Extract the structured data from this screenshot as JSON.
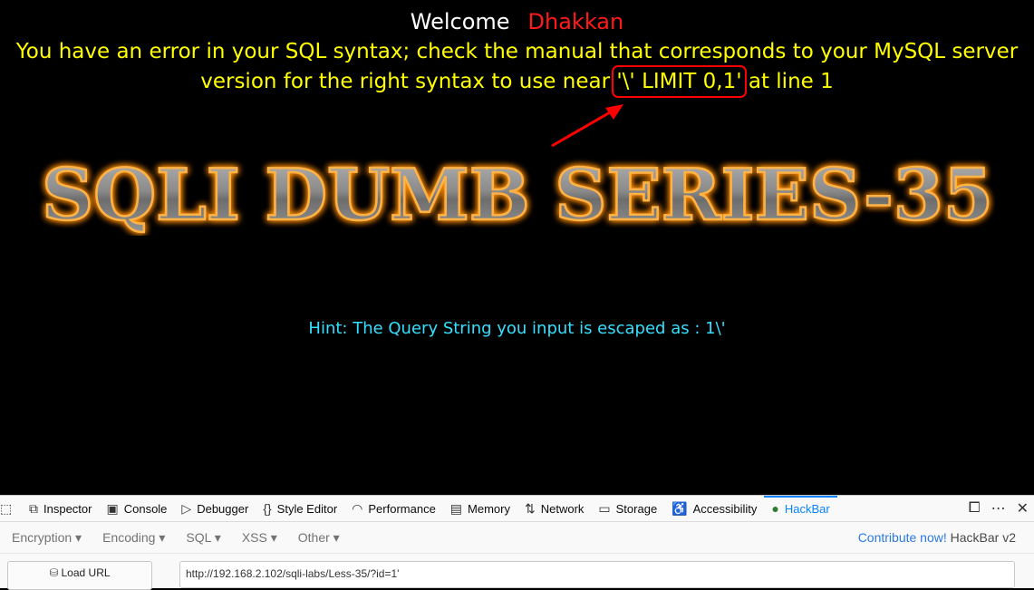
{
  "page": {
    "welcome_label": "Welcome",
    "welcome_name": "Dhakkan",
    "error_part1": "You have an error in your SQL syntax; check the manual that corresponds to your MySQL server version for the right syntax to use near ",
    "error_highlight": "'\\' LIMIT 0,1'",
    "error_part2": " at line 1",
    "banner_text": "SQLI DUMB SERIES-35",
    "hint": "Hint: The Query String you input is escaped as : 1\\'"
  },
  "devtools": {
    "tabs": [
      {
        "label": "Inspector",
        "icon": "inspector-icon"
      },
      {
        "label": "Console",
        "icon": "console-icon"
      },
      {
        "label": "Debugger",
        "icon": "debugger-icon"
      },
      {
        "label": "Style Editor",
        "icon": "style-editor-icon"
      },
      {
        "label": "Performance",
        "icon": "performance-icon"
      },
      {
        "label": "Memory",
        "icon": "memory-icon"
      },
      {
        "label": "Network",
        "icon": "network-icon"
      },
      {
        "label": "Storage",
        "icon": "storage-icon"
      },
      {
        "label": "Accessibility",
        "icon": "accessibility-icon"
      },
      {
        "label": "HackBar",
        "icon": "hackbar-icon"
      }
    ],
    "active_tab": "HackBar"
  },
  "hackbar": {
    "menus": [
      "Encryption",
      "Encoding",
      "SQL",
      "XSS",
      "Other"
    ],
    "contribute_link": "Contribute now!",
    "version": "HackBar v2",
    "load_url_label": "Load URL",
    "url_value": "http://192.168.2.102/sqli-labs/Less-35/?id=1'"
  },
  "colors": {
    "error_text": "#ffff00",
    "welcome_name": "#ff1a1a",
    "hint": "#35e0ff",
    "highlight_box": "#ff0000",
    "active_tab": "#0a84ff"
  }
}
